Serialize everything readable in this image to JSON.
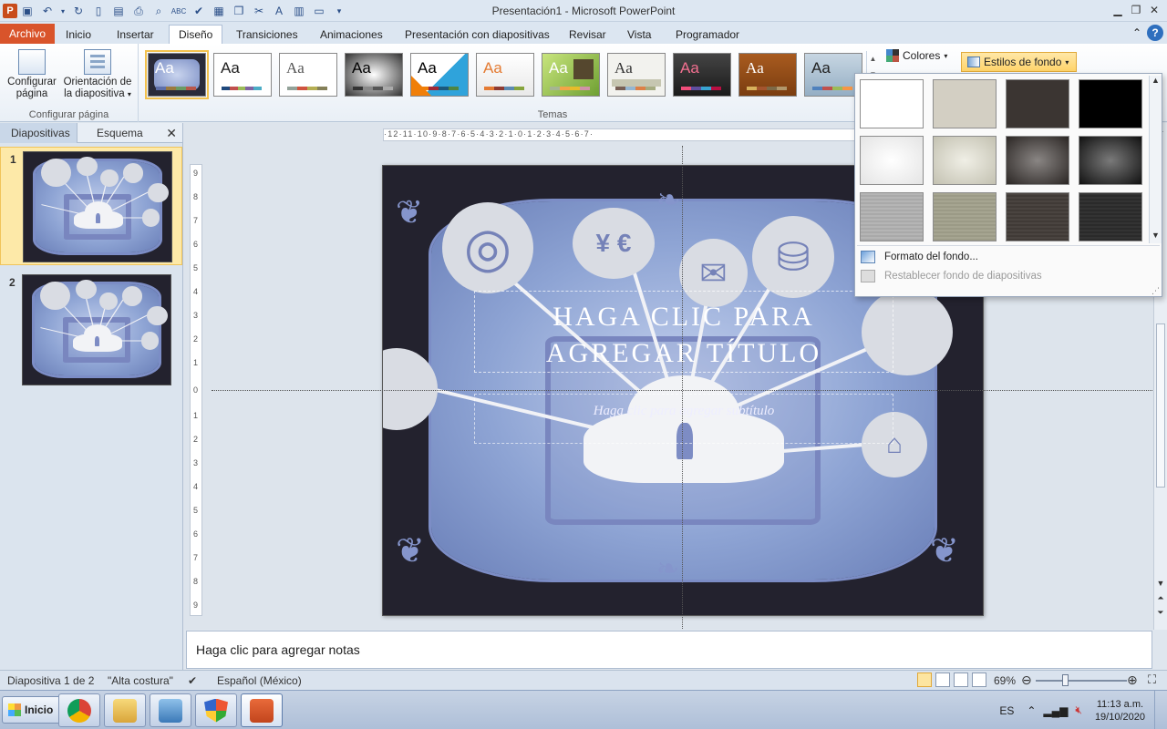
{
  "window": {
    "title": "Presentación1  -  Microsoft PowerPoint",
    "app_logo": "P"
  },
  "tabs": [
    {
      "label": "Archivo"
    },
    {
      "label": "Inicio"
    },
    {
      "label": "Insertar"
    },
    {
      "label": "Diseño"
    },
    {
      "label": "Transiciones"
    },
    {
      "label": "Animaciones"
    },
    {
      "label": "Presentación con diapositivas"
    },
    {
      "label": "Revisar"
    },
    {
      "label": "Vista"
    },
    {
      "label": "Programador"
    }
  ],
  "active_tab": "Diseño",
  "ribbon": {
    "page_setup": {
      "config_label_1": "Configurar",
      "config_label_2": "página",
      "orient_label_1": "Orientación de",
      "orient_label_2": "la diapositiva",
      "group_label": "Configurar página"
    },
    "themes_group_label": "Temas",
    "theme_sample_text": "Aa",
    "colors_label": "Colores",
    "background_styles_label": "Estilos de fondo"
  },
  "left_panel": {
    "tabs": [
      "Diapositivas",
      "Esquema"
    ],
    "close_glyph": "✕",
    "slides": [
      {
        "number": "1",
        "selected": true
      },
      {
        "number": "2",
        "selected": false
      }
    ]
  },
  "slide": {
    "title_line_1": "HAGA CLIC PARA",
    "title_line_2": "AGREGAR TÍTULO",
    "subtitle": "Haga clic para agregar subtítulo",
    "currency_glyphs": "¥ €",
    "envelope_glyph": "✉"
  },
  "rulers": {
    "horizontal": "·12·11·10·9·8·7·6·5·4·3·2·1·0·1·2·3·4·5·6·7·",
    "vertical": [
      "9",
      "8",
      "7",
      "6",
      "5",
      "4",
      "3",
      "2",
      "1",
      "0",
      "1",
      "2",
      "3",
      "4",
      "5",
      "6",
      "7",
      "8",
      "9"
    ]
  },
  "notes": {
    "placeholder": "Haga clic para agregar notas"
  },
  "status_bar": {
    "slide_info": "Diapositiva 1 de 2",
    "theme_name": "\"Alta costura\"",
    "language": "Español (México)",
    "zoom": "69%"
  },
  "dropdown": {
    "menu_item_1": "Formato del fondo...",
    "menu_item_2": "Restablecer fondo de diapositivas",
    "swatches": [
      "#ffffff",
      "#d3cfc3",
      "#3b3532",
      "#000000",
      "#f3f3f3",
      "#d8d6c8",
      "#494644",
      "#2c2c2c",
      "#a9a9a9",
      "#9b9a86",
      "#403a36",
      "#2a2a2a"
    ]
  },
  "taskbar": {
    "start_label": "Inicio",
    "language": "ES",
    "time": "11:13 a.m.",
    "date": "19/10/2020"
  },
  "colors": {
    "file_tab": "#d9542b",
    "accent_selected": "#f2c14e"
  }
}
